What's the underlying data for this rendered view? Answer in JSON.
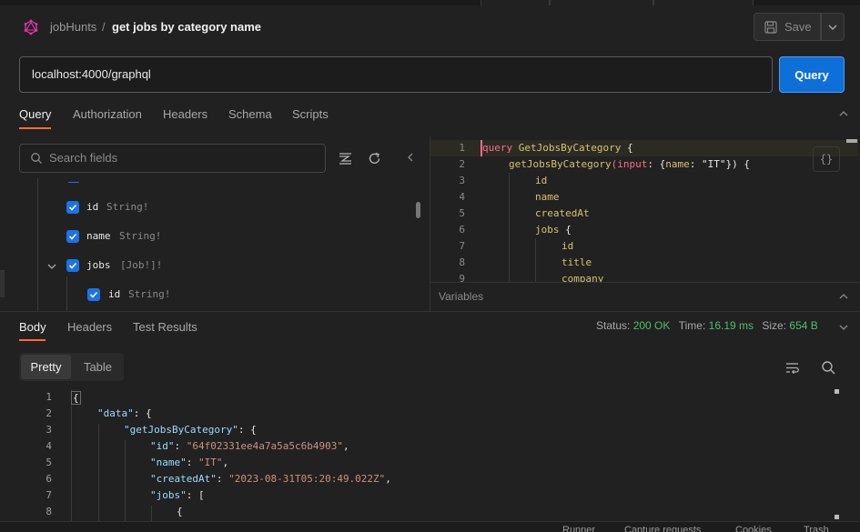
{
  "breadcrumb": {
    "collection": "jobHunts",
    "separator": "/",
    "request": "get jobs by category name"
  },
  "toolbar": {
    "save_label": "Save"
  },
  "url": {
    "value": "localhost:4000/graphql"
  },
  "query_button": {
    "label": "Query"
  },
  "request_tabs": [
    {
      "label": "Query",
      "active": true
    },
    {
      "label": "Authorization"
    },
    {
      "label": "Headers"
    },
    {
      "label": "Schema"
    },
    {
      "label": "Scripts"
    }
  ],
  "schema": {
    "search_placeholder": "Search fields",
    "fields": [
      {
        "name": "id",
        "type": "String!"
      },
      {
        "name": "name",
        "type": "String!"
      },
      {
        "name": "jobs",
        "type": "[Job!]!"
      },
      {
        "name": "id",
        "type": "String!"
      }
    ]
  },
  "editor": {
    "line_numbers": [
      "1",
      "2",
      "3",
      "4",
      "5",
      "6",
      "7",
      "8",
      "9"
    ],
    "lines": [
      {
        "kw": "query",
        "fn": "GetJobsByCategory",
        "rest": " {"
      },
      {
        "fn": "getJobsByCategory",
        "p1": "(",
        "arg": "input",
        "p2": ": {",
        "k": "name",
        "p3": ": ",
        "s": "\"IT\"",
        "p4": "}) {"
      },
      {
        "fn": "id"
      },
      {
        "fn": "name"
      },
      {
        "fn": "createdAt"
      },
      {
        "fn": "jobs",
        "rest": " {"
      },
      {
        "fn": "id"
      },
      {
        "fn": "title"
      },
      {
        "fn": "company"
      }
    ],
    "prettify_glyph": "{}"
  },
  "variables": {
    "label": "Variables"
  },
  "response_tabs": [
    {
      "label": "Body",
      "active": true
    },
    {
      "label": "Headers"
    },
    {
      "label": "Test Results"
    }
  ],
  "status": {
    "status_label": "Status:",
    "status_value": "200 OK",
    "time_label": "Time:",
    "time_value": "16.19 ms",
    "size_label": "Size:",
    "size_value": "654 B"
  },
  "view_modes": {
    "pretty": "Pretty",
    "table": "Table"
  },
  "response": {
    "line_numbers": [
      "1",
      "2",
      "3",
      "4",
      "5",
      "6",
      "7",
      "8"
    ],
    "lines": [
      "{",
      "\"data\": {",
      "\"getJobsByCategory\": {",
      "\"id\": \"64f02331ee4a7a5a5c6b4903\",",
      "\"name\": \"IT\",",
      "\"createdAt\": \"2023-08-31T05:20:49.022Z\",",
      "\"jobs\": [",
      "{"
    ],
    "l2_key": "\"data\"",
    "l3_key": "\"getJobsByCategory\"",
    "l4_key": "\"id\"",
    "l4_val": "\"64f02331ee4a7a5a5c6b4903\"",
    "l5_key": "\"name\"",
    "l5_val": "\"IT\"",
    "l6_key": "\"createdAt\"",
    "l6_val": "\"2023-08-31T05:20:49.022Z\"",
    "l7_key": "\"jobs\""
  },
  "footer": {
    "runner": "Runner",
    "capture": "Capture requests",
    "cookies": "Cookies",
    "trash": "Trash"
  },
  "colors": {
    "accent": "#ff6c37",
    "primary_button": "#0e6fd9",
    "checkbox": "#1a73e8",
    "ok": "#4fbf6b"
  }
}
